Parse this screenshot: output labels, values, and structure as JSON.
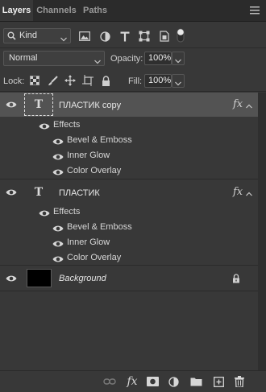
{
  "tabs": [
    {
      "label": "Layers",
      "active": true
    },
    {
      "label": "Channels",
      "active": false
    },
    {
      "label": "Paths",
      "active": false
    }
  ],
  "filter": {
    "kind_label": "Kind",
    "icons": [
      "image-filter-icon",
      "adjustment-filter-icon",
      "type-filter-icon",
      "shape-filter-icon",
      "smart-object-filter-icon",
      "filter-toggle-icon"
    ]
  },
  "blend": {
    "mode": "Normal",
    "opacity_label": "Opacity:",
    "opacity_value": "100%"
  },
  "lock": {
    "label": "Lock:",
    "fill_label": "Fill:",
    "fill_value": "100%"
  },
  "layers": [
    {
      "name": "ПЛАСТИК copy",
      "type_glyph": "T",
      "selected": true,
      "effects_label": "Effects",
      "effects": [
        "Bevel & Emboss",
        "Inner Glow",
        "Color Overlay"
      ],
      "fx": "fx"
    },
    {
      "name": "ПЛАСТИК",
      "type_glyph": "T",
      "selected": false,
      "effects_label": "Effects",
      "effects": [
        "Bevel & Emboss",
        "Inner Glow",
        "Color Overlay"
      ],
      "fx": "fx"
    },
    {
      "name": "Background",
      "locked": true
    }
  ],
  "bottom_bar": {
    "fx_label": "fx",
    "icons": [
      "link-layers-icon",
      "add-style-icon",
      "add-mask-icon",
      "new-adjustment-icon",
      "new-group-icon",
      "new-layer-icon",
      "delete-layer-icon"
    ]
  },
  "colors": {
    "panel_bg": "#383838",
    "selected_bg": "#535353",
    "tabbar_bg": "#2b2b2b"
  }
}
